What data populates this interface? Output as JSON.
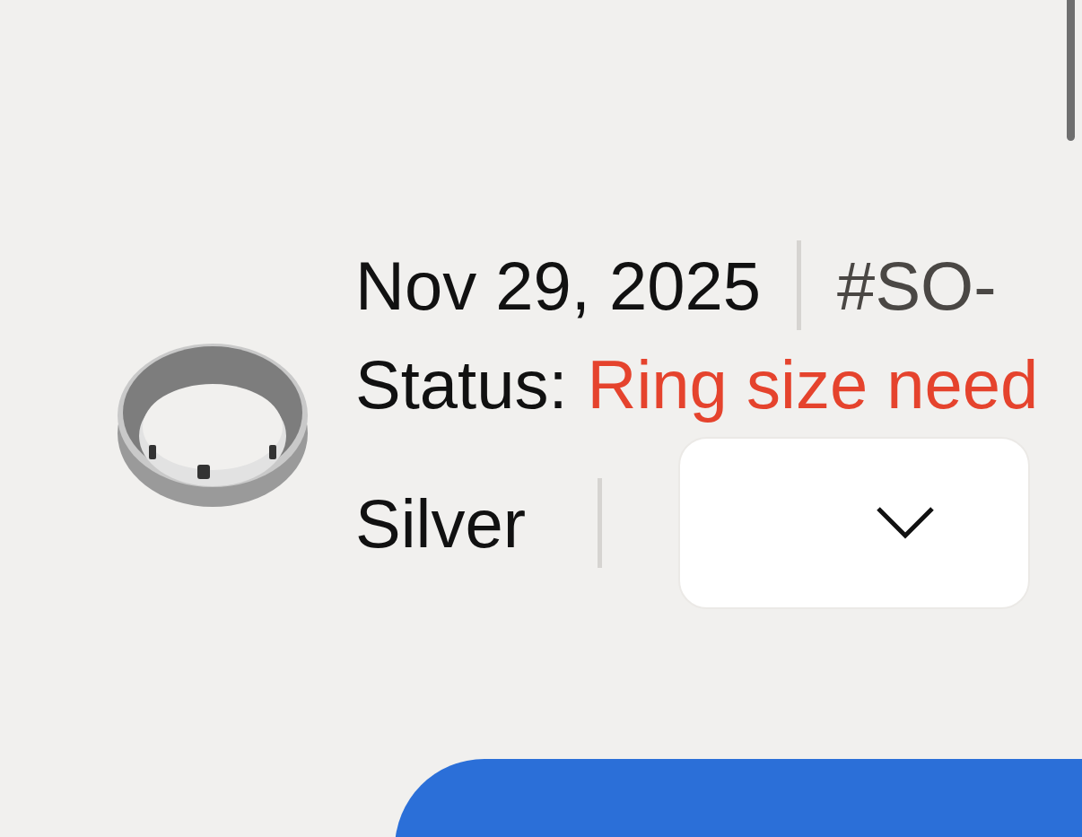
{
  "order": {
    "date": "Nov 29, 2025",
    "number": "#SO-",
    "status_label": "Status:",
    "status": "Ring size need",
    "finish": "Silver"
  }
}
